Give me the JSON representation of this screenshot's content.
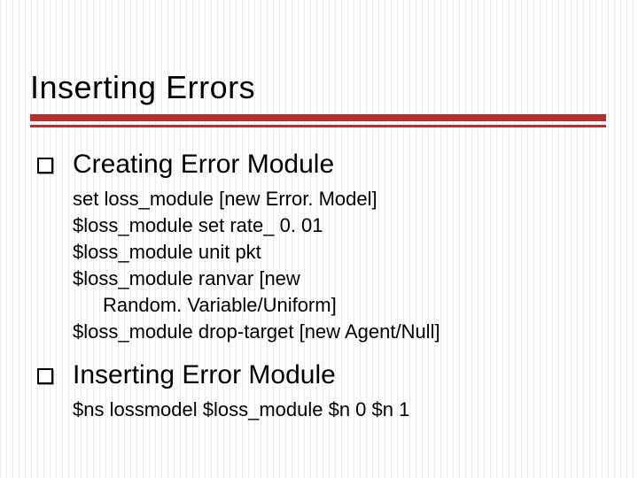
{
  "title": "Inserting Errors",
  "sections": [
    {
      "heading": "Creating Error Module",
      "code": [
        "set loss_module [new Error. Model]",
        "$loss_module set rate_ 0. 01",
        "$loss_module unit pkt",
        "$loss_module ranvar [new",
        "Random. Variable/Uniform]",
        "$loss_module drop-target [new Agent/Null]"
      ],
      "cont_indices": [
        4
      ]
    },
    {
      "heading": "Inserting Error Module",
      "code": [
        "$ns lossmodel $loss_module $n 0 $n 1"
      ],
      "cont_indices": []
    }
  ]
}
